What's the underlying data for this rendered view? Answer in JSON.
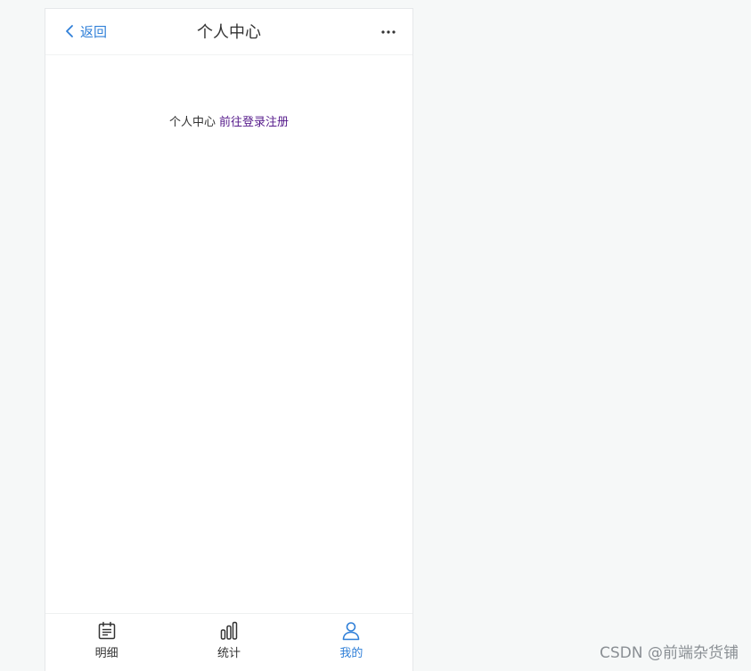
{
  "navbar": {
    "back_label": "返回",
    "title": "个人中心",
    "back_icon": "chevron-left-icon",
    "more_icon": "ellipsis-icon"
  },
  "content": {
    "text": "个人中心",
    "link": "前往登录注册"
  },
  "tabbar": {
    "items": [
      {
        "label": "明细",
        "icon": "calendar-list-icon",
        "active": false
      },
      {
        "label": "统计",
        "icon": "bar-chart-icon",
        "active": false
      },
      {
        "label": "我的",
        "icon": "user-icon",
        "active": true
      }
    ]
  },
  "colors": {
    "accent": "#2f7fd8",
    "link": "#551a8b",
    "text": "#333333",
    "background": "#f6f8f8"
  },
  "watermark": "CSDN @前端杂货铺"
}
